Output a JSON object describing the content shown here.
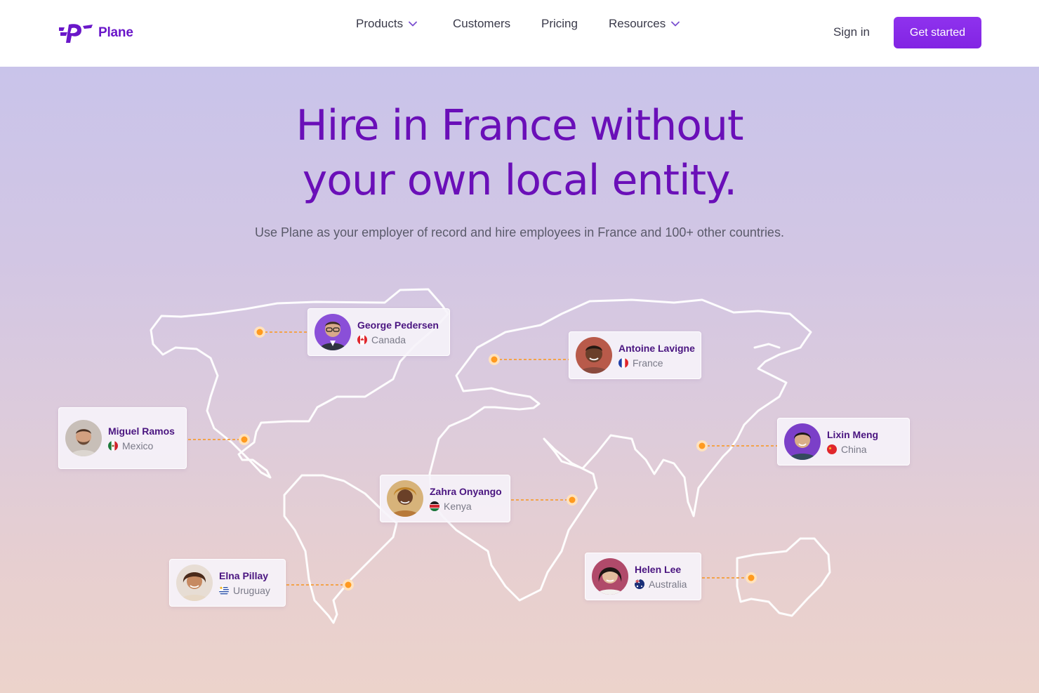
{
  "header": {
    "logo_text": "Plane",
    "nav": {
      "products": "Products",
      "customers": "Customers",
      "pricing": "Pricing",
      "resources": "Resources"
    },
    "sign_in": "Sign in",
    "cta": "Get started"
  },
  "hero": {
    "title_line1": "Hire in France without",
    "title_line2": "your own local entity.",
    "subtitle": "Use Plane as your employer of record and hire employees in France and 100+ other countries."
  },
  "people": [
    {
      "name": "George Pedersen",
      "country": "Canada"
    },
    {
      "name": "Antoine Lavigne",
      "country": "France"
    },
    {
      "name": "Miguel Ramos",
      "country": "Mexico"
    },
    {
      "name": "Lixin Meng",
      "country": "China"
    },
    {
      "name": "Zahra Onyango",
      "country": "Kenya"
    },
    {
      "name": "Elna Pillay",
      "country": "Uruguay"
    },
    {
      "name": "Helen Lee",
      "country": "Australia"
    }
  ],
  "colors": {
    "brand": "#6a17c9",
    "cta": "#8a2be2",
    "heading": "#6a0fb8",
    "pin": "#ff9a1f"
  }
}
